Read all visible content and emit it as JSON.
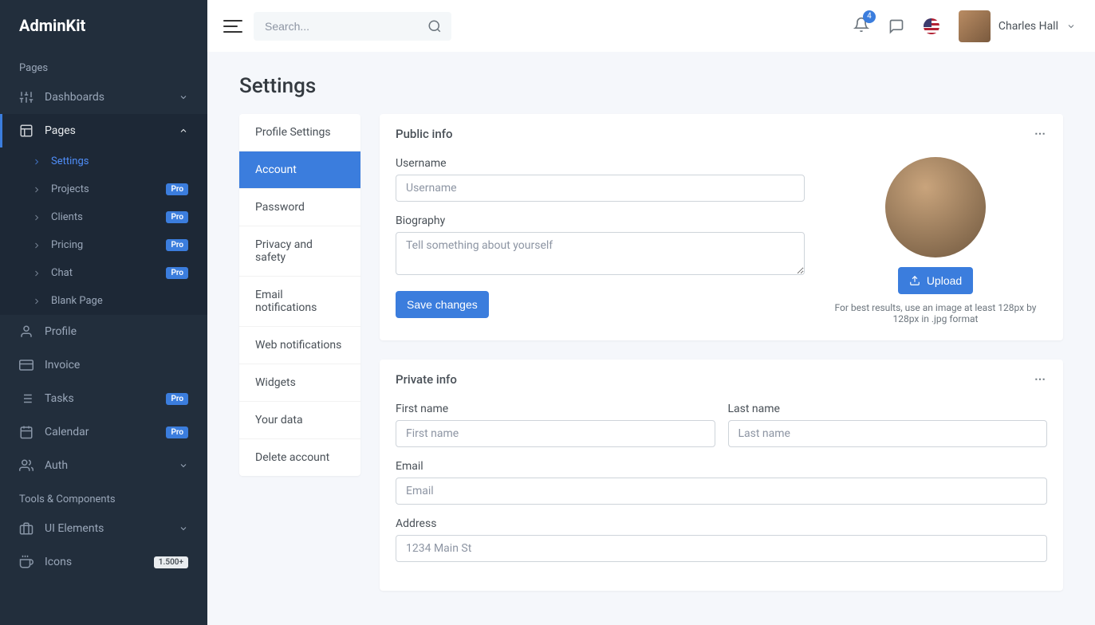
{
  "brand": "AdminKit",
  "search": {
    "placeholder": "Search..."
  },
  "notifications": {
    "count": "4"
  },
  "user": {
    "name": "Charles Hall"
  },
  "sidebar": {
    "section_pages": "Pages",
    "dashboards": "Dashboards",
    "pages": "Pages",
    "pages_children": {
      "settings": "Settings",
      "projects": "Projects",
      "clients": "Clients",
      "pricing": "Pricing",
      "chat": "Chat",
      "blank": "Blank Page"
    },
    "profile": "Profile",
    "invoice": "Invoice",
    "tasks": "Tasks",
    "calendar": "Calendar",
    "auth": "Auth",
    "section_tools": "Tools & Components",
    "ui_elements": "UI Elements",
    "icons": "Icons",
    "icons_badge": "1.500+",
    "badge_pro": "Pro"
  },
  "page": {
    "title": "Settings"
  },
  "settings_nav": {
    "profile_settings": "Profile Settings",
    "account": "Account",
    "password": "Password",
    "privacy": "Privacy and safety",
    "email_noti": "Email notifications",
    "web_noti": "Web notifications",
    "widgets": "Widgets",
    "your_data": "Your data",
    "delete_account": "Delete account"
  },
  "public_info": {
    "title": "Public info",
    "username_label": "Username",
    "username_placeholder": "Username",
    "bio_label": "Biography",
    "bio_placeholder": "Tell something about yourself",
    "save": "Save changes",
    "upload": "Upload",
    "hint": "For best results, use an image at least 128px by 128px in .jpg format"
  },
  "private_info": {
    "title": "Private info",
    "first_label": "First name",
    "first_placeholder": "First name",
    "last_label": "Last name",
    "last_placeholder": "Last name",
    "email_label": "Email",
    "email_placeholder": "Email",
    "address_label": "Address",
    "address_placeholder": "1234 Main St"
  }
}
